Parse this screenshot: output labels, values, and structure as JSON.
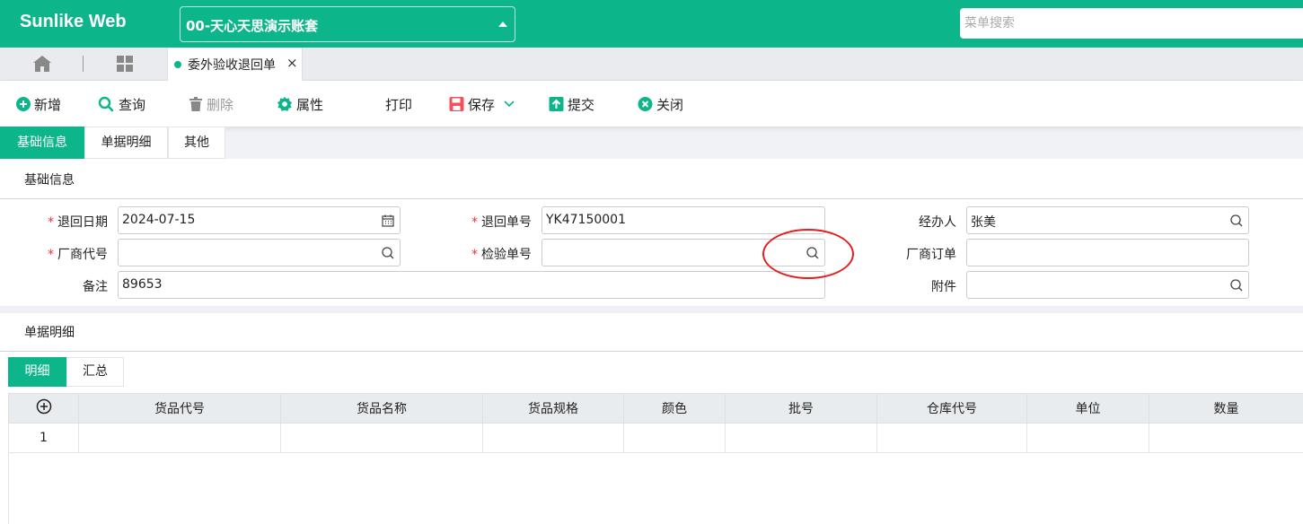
{
  "header": {
    "brand": "Sunlike Web",
    "account": "00-天心天思演示账套",
    "menu_search_placeholder": "菜单搜索"
  },
  "tabs": {
    "active_label": "委外验收退回单",
    "close_glyph": "×"
  },
  "toolbar": {
    "add": "新增",
    "query": "查询",
    "delete": "删除",
    "properties": "属性",
    "print": "打印",
    "save": "保存",
    "submit": "提交",
    "close": "关闭"
  },
  "section_tabs": [
    "基础信息",
    "单据明细",
    "其他"
  ],
  "basic_info": {
    "title": "基础信息",
    "fields": {
      "return_date": {
        "label": "退回日期",
        "value": "2024-07-15",
        "required": true
      },
      "return_no": {
        "label": "退回单号",
        "value": "YK47150001",
        "required": true
      },
      "handler": {
        "label": "经办人",
        "value": "张美",
        "required": false
      },
      "vendor_code": {
        "label": "厂商代号",
        "value": "",
        "required": true
      },
      "inspection_no": {
        "label": "检验单号",
        "value": "",
        "required": true
      },
      "vendor_order": {
        "label": "厂商订单",
        "value": "",
        "required": false
      },
      "remark": {
        "label": "备注",
        "value": "89653",
        "required": false
      },
      "attachment": {
        "label": "附件",
        "value": "",
        "required": false
      }
    }
  },
  "detail": {
    "title": "单据明细",
    "subtabs": [
      "明细",
      "汇总"
    ],
    "columns": [
      "货品代号",
      "货品名称",
      "货品规格",
      "颜色",
      "批号",
      "仓库代号",
      "单位",
      "数量"
    ],
    "rows": [
      {
        "no": "1",
        "cells": [
          "",
          "",
          "",
          "",
          "",
          "",
          "",
          ""
        ]
      }
    ]
  },
  "colors": {
    "accent": "#0db58b",
    "required": "#e33333",
    "highlight_circle": "#e41e1e"
  },
  "required_mark": "*"
}
